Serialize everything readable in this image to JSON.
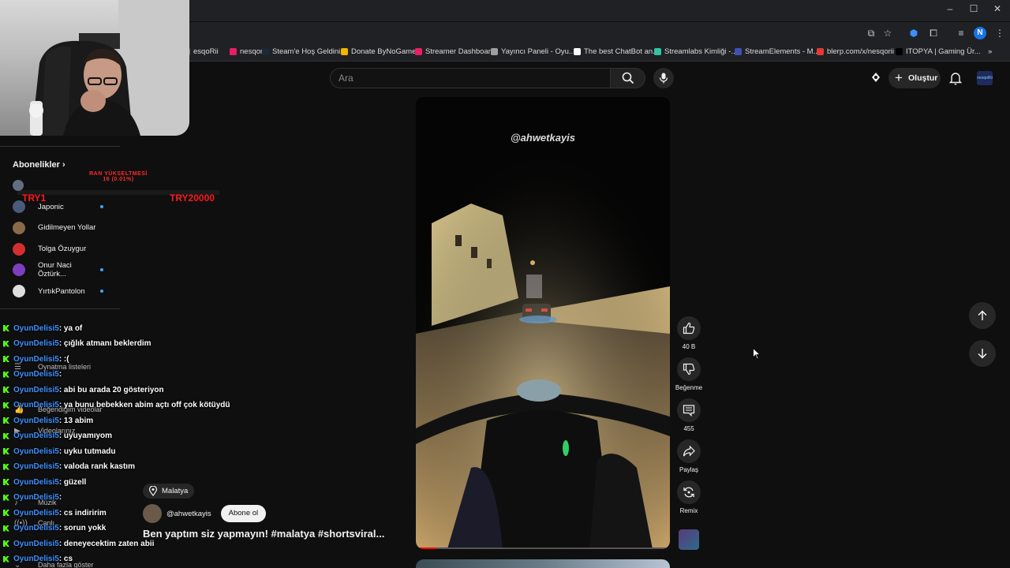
{
  "browser": {
    "window_controls": [
      "–",
      "☐",
      "✕"
    ],
    "address": "/",
    "profile_initial": "N",
    "bookmarks": [
      {
        "label": "esqoRii",
        "color": "#666"
      },
      {
        "label": "nesqorii",
        "color": "#e91e63"
      },
      {
        "label": "Steam'e Hoş Geldiniz",
        "color": "#1b2838"
      },
      {
        "label": "Donate ByNoGame",
        "color": "#f4b400"
      },
      {
        "label": "Streamer Dashboard",
        "color": "#e91e63"
      },
      {
        "label": "Yayıncı Paneli - Oyu...",
        "color": "#9e9e9e"
      },
      {
        "label": "The best ChatBot an...",
        "color": "#ffffff"
      },
      {
        "label": "Streamlabs Kimliği -...",
        "color": "#31c3a2"
      },
      {
        "label": "StreamElements - M...",
        "color": "#3f51b5"
      },
      {
        "label": "blerp.com/x/nesqorii",
        "color": "#e53935"
      },
      {
        "label": "ITOPYA | Gaming Ür...",
        "color": "#000000"
      }
    ]
  },
  "youtube": {
    "search_placeholder": "Ara",
    "create_label": "Oluştur",
    "avatar_text": "nesqoRii"
  },
  "sidebar": {
    "subscriptions_heading": "Abonelikler",
    "subscriptions": [
      {
        "name": "Japonic",
        "live": true,
        "color": "#4a5a7a"
      },
      {
        "name": "Gidilmeyen Yollar",
        "live": false,
        "color": "#8a6a4a"
      },
      {
        "name": "Tolga Özuygur",
        "live": false,
        "color": "#d32f2f"
      },
      {
        "name": "Onur Naci Öztürk...",
        "live": true,
        "color": "#7e3fbf"
      },
      {
        "name": "YırtıkPantolon",
        "live": true,
        "color": "#dddddd"
      }
    ],
    "ghost_items": [
      {
        "label": "Oynatma listeleri",
        "icon": "☰"
      },
      {
        "label": "Beğendiğim videolar",
        "icon": "👍"
      },
      {
        "label": "Videolarınız",
        "icon": "▶"
      },
      {
        "label": "Müzik",
        "icon": "♪"
      },
      {
        "label": "Canlı",
        "icon": "((•))"
      },
      {
        "label": "Daha fazla göster",
        "icon": "⌄"
      }
    ]
  },
  "overlay": {
    "rank_title": "RAN YÜKSELTMESİ",
    "rank_progress": "16 (0.01%)",
    "rank_left": "TRY1",
    "rank_right": "TRY20000"
  },
  "chat": [
    {
      "user": "OyunDelisi5",
      "msg": ": ya of"
    },
    {
      "user": "OyunDelisi5",
      "msg": ": çığlık atmanı beklerdim"
    },
    {
      "user": "OyunDelisi5",
      "msg": ": :("
    },
    {
      "user": "OyunDelisi5",
      "msg": ":"
    },
    {
      "user": "OyunDelisi5",
      "msg": ": abi bu arada 20 gösteriyon"
    },
    {
      "user": "OyunDelisi5",
      "msg": ": ya bunu bebekken abim açtı off çok kötüydü"
    },
    {
      "user": "OyunDelisi5",
      "msg": ": 13 abim"
    },
    {
      "user": "OyunDelisi5",
      "msg": ": uyuyamıyom"
    },
    {
      "user": "OyunDelisi5",
      "msg": ": uyku tutmadu"
    },
    {
      "user": "OyunDelisi5",
      "msg": ": valoda rank kastım"
    },
    {
      "user": "OyunDelisi5",
      "msg": ": güzell"
    },
    {
      "user": "OyunDelisi5",
      "msg": ":"
    },
    {
      "user": "OyunDelisi5",
      "msg": ": cs indiririm"
    },
    {
      "user": "OyunDelisi5",
      "msg": ": sorun yokk"
    },
    {
      "user": "OyunDelisi5",
      "msg": ": deneyecektim zaten abii"
    },
    {
      "user": "OyunDelisi5",
      "msg": ": cs"
    }
  ],
  "short": {
    "watermark": "@ahwetkayis",
    "location": "Malatya",
    "channel": "@ahwetkayis",
    "subscribe_label": "Abone ol",
    "title": "Ben yaptım siz yapmayın! #malatya #shortsviral...",
    "progress": 0.08,
    "likes": "40 B",
    "dislike_label": "Beğenme",
    "comments": "455",
    "share_label": "Paylaş",
    "remix_label": "Remix"
  }
}
